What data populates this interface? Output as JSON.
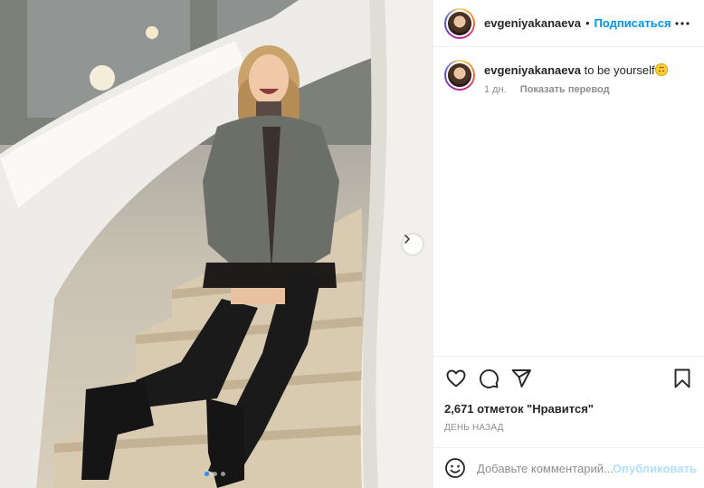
{
  "post": {
    "username": "evgeniyakanaeva",
    "separator": "•",
    "follow_label": "Подписаться",
    "more_icon": "more-horizontal-icon",
    "caption": {
      "username": "evgeniyakanaeva",
      "text": " to be yourself",
      "emoji": "upside-down-smile-emoji",
      "time": "1 дн.",
      "translate_label": "Показать перевод"
    },
    "actions": {
      "like_icon": "heart-icon",
      "comment_icon": "comment-icon",
      "share_icon": "share-icon",
      "save_icon": "bookmark-icon"
    },
    "likes_text": "2,671 отметок \"Нравится\"",
    "time_ago": "День назад",
    "comment": {
      "placeholder": "Добавьте комментарий...",
      "publish_label": "Опубликовать"
    }
  },
  "carousel": {
    "slide_count": 3,
    "active_index": 0,
    "next_icon": "chevron-right-icon"
  },
  "colors": {
    "link_blue": "#0095f6",
    "publish_disabled": "#b2dffc",
    "muted_text": "#8e8e8e",
    "border": "#efefef"
  }
}
